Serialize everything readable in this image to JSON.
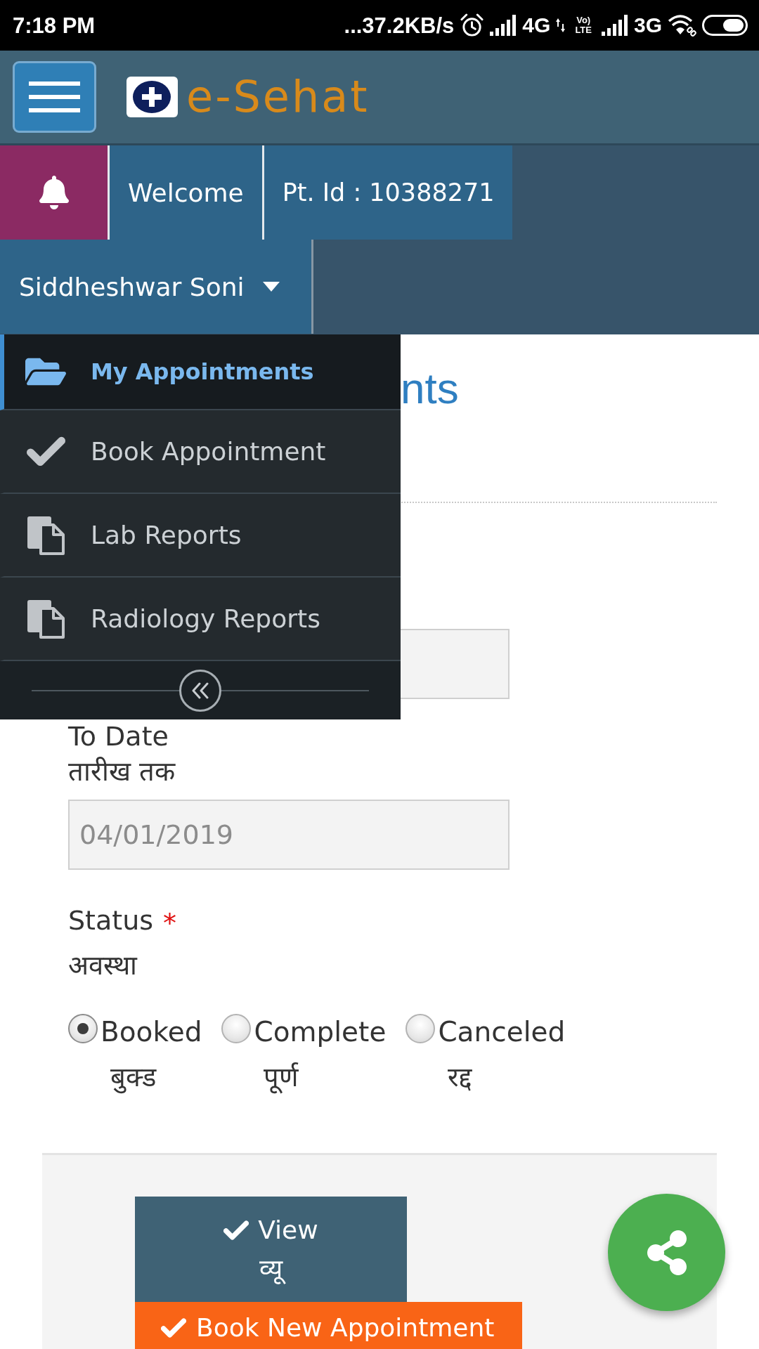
{
  "status_bar": {
    "time": "7:18 PM",
    "speed": "...37.2KB/s",
    "network_1": "4G",
    "volte": {
      "top": "Vo)",
      "bottom": "LTE"
    },
    "network_2": "3G"
  },
  "header": {
    "logo_text": "e-Sehat"
  },
  "nav": {
    "welcome": "Welcome",
    "patient_id": "Pt. Id : 10388271",
    "user_name": "Siddheshwar Soni"
  },
  "menu": {
    "items": [
      {
        "label": "My Appointments",
        "kind": "folder",
        "selected": true
      },
      {
        "label": "Book Appointment",
        "kind": "check",
        "selected": false
      },
      {
        "label": "Lab Reports",
        "kind": "documents",
        "selected": false
      },
      {
        "label": "Radiology Reports",
        "kind": "documents",
        "selected": false
      }
    ]
  },
  "page": {
    "heading": "nts",
    "to_date": {
      "label": "To Date",
      "label_hi": "तारीख तक",
      "value": "04/01/2019"
    },
    "status": {
      "label": "Status",
      "required_mark": "*",
      "label_hi": "अवस्था",
      "options": [
        {
          "label": "Booked",
          "label_hi": "बुक्ड",
          "selected": true
        },
        {
          "label": "Complete",
          "label_hi": "पूर्ण",
          "selected": false
        },
        {
          "label": "Canceled",
          "label_hi": "रद्द",
          "selected": false
        }
      ]
    },
    "buttons": {
      "view": {
        "label": "View",
        "label_hi": "व्यू"
      },
      "book_new": {
        "label": "Book New Appointment"
      }
    }
  }
}
